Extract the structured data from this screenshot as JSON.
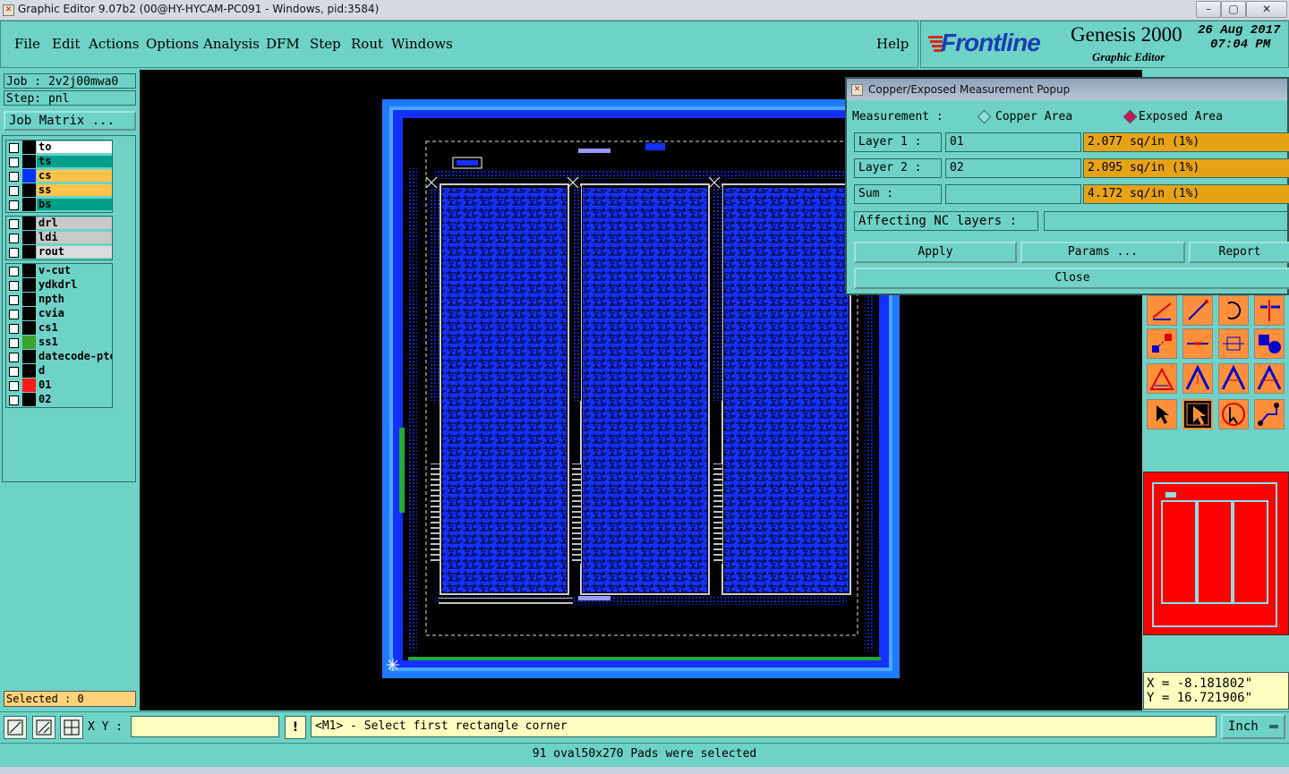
{
  "window": {
    "title": "Graphic Editor 9.07b2 (00@HY-HYCAM-PC091 - Windows, pid:3584)",
    "minimize": "–",
    "maximize": "▢",
    "close": "✕"
  },
  "menu": {
    "items": [
      "File",
      "Edit",
      "Actions",
      "Options",
      "Analysis",
      "DFM",
      "Step",
      "Rout",
      "Windows"
    ],
    "help": "Help"
  },
  "brand": {
    "logo": "Frontline",
    "product": "Genesis 2000",
    "subtitle": "Graphic Editor",
    "date": "26 Aug 2017",
    "time": "07:04 PM"
  },
  "left": {
    "job": "Job : 2v2j00mwa0",
    "step": "Step: pnl",
    "job_matrix": "Job Matrix ...",
    "layer_groups": [
      [
        {
          "name": "to",
          "bg": "#ffffff",
          "swatch": "#000000"
        },
        {
          "name": "ts",
          "bg": "#00a08a",
          "swatch": "#000000"
        },
        {
          "name": "cs",
          "bg": "#ffc34a",
          "swatch": "#0033ff"
        },
        {
          "name": "ss",
          "bg": "#ffc34a",
          "swatch": "#000000"
        },
        {
          "name": "bs",
          "bg": "#00a08a",
          "swatch": "#000000"
        }
      ],
      [
        {
          "name": "drl",
          "bg": "#c9c9c9",
          "swatch": "#000000"
        },
        {
          "name": "ldi",
          "bg": "#c9c9c9",
          "swatch": "#000000"
        },
        {
          "name": "rout",
          "bg": "#dcdcdc",
          "swatch": "#000000"
        }
      ],
      [
        {
          "name": "v-cut",
          "bg": "#6fd2c6",
          "swatch": "#000000"
        },
        {
          "name": "ydkdrl",
          "bg": "#6fd2c6",
          "swatch": "#000000"
        },
        {
          "name": "npth",
          "bg": "#6fd2c6",
          "swatch": "#000000"
        },
        {
          "name": "cvia",
          "bg": "#6fd2c6",
          "swatch": "#000000"
        },
        {
          "name": "cs1",
          "bg": "#6fd2c6",
          "swatch": "#000000"
        },
        {
          "name": "ss1",
          "bg": "#6fd2c6",
          "swatch": "#3aa32a"
        },
        {
          "name": "datecode-pto",
          "bg": "#6fd2c6",
          "swatch": "#000000"
        },
        {
          "name": "d",
          "bg": "#6fd2c6",
          "swatch": "#000000"
        },
        {
          "name": "01",
          "bg": "#6fd2c6",
          "swatch": "#ff1a1a"
        },
        {
          "name": "02",
          "bg": "#6fd2c6",
          "swatch": "#000000"
        }
      ]
    ],
    "selected": "Selected : 0"
  },
  "popup": {
    "title": "Copper/Exposed Measurement Popup",
    "measurement_label": "Measurement   :",
    "option_copper": "Copper Area",
    "option_exposed": "Exposed Area",
    "selected_option": "exposed",
    "layer1_label": "Layer 1 :",
    "layer1_value": "01",
    "layer1_result": "2.077 sq/in (1%)",
    "layer2_label": "Layer 2 :",
    "layer2_value": "02",
    "layer2_result": "2.095 sq/in (1%)",
    "sum_label": "Sum     :",
    "sum_result": "4.172 sq/in (1%)",
    "affecting_label": "Affecting NC layers :",
    "affecting_value": "",
    "apply": "Apply",
    "params": "Params ...",
    "report": "Report",
    "close": "Close"
  },
  "coords": {
    "x": "X = -8.181802\"",
    "y": "Y = 16.721906\""
  },
  "bottom": {
    "xy_label": "X Y :",
    "xy_value": "",
    "prompt": "<M1> - Select first rectangle corner",
    "units": "Inch",
    "status": "91 oval50x270 Pads were selected"
  },
  "colors": {
    "panel": "#6fd2c6",
    "board_blue": "#1430ff",
    "frame_blue": "#1e7bff",
    "minimap_red": "#ff0000",
    "result_orange": "#e6a415"
  }
}
